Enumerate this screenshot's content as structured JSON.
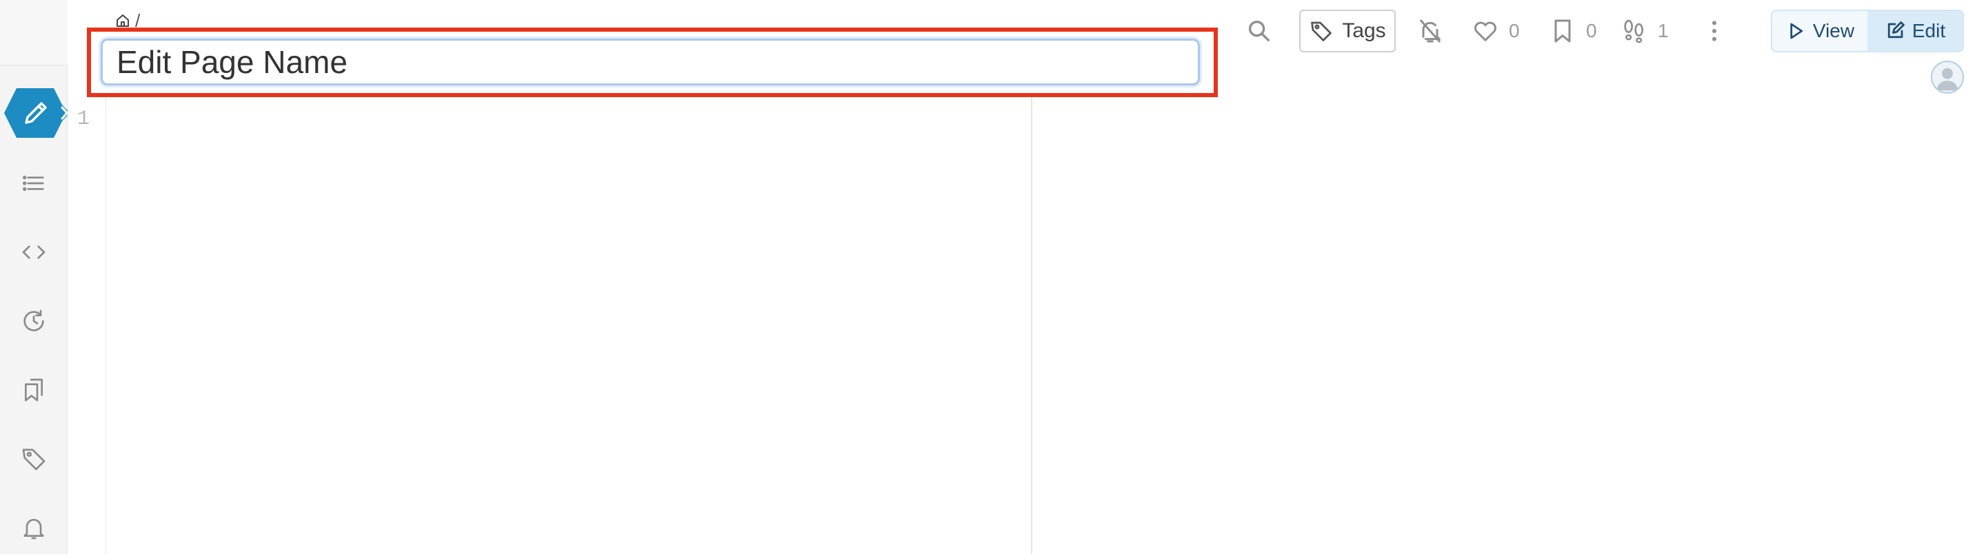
{
  "breadcrumb": {
    "separator": "/"
  },
  "page_name": {
    "value": "Edit Page Name"
  },
  "toolbar": {
    "tags_label": "Tags",
    "like_count": "0",
    "bookmark_count": "0",
    "seen_count": "1",
    "view_label": "View",
    "edit_label": "Edit"
  },
  "editor": {
    "line_number": "1"
  },
  "icons": {
    "sidebar": [
      "pencil-icon",
      "list-icon",
      "code-icon",
      "history-icon",
      "bookmarks-icon",
      "tag-icon",
      "bell-icon"
    ],
    "toolbar": [
      "search-icon",
      "tag-icon",
      "bell-off-icon",
      "heart-icon",
      "bookmark-icon",
      "footprints-icon",
      "more-vertical-icon",
      "play-icon",
      "edit-icon"
    ]
  },
  "colors": {
    "accent": "#1c8cc2",
    "highlight": "#e8331c",
    "input_border": "#a9c8ec",
    "mode_active": "#d8ebf7"
  }
}
